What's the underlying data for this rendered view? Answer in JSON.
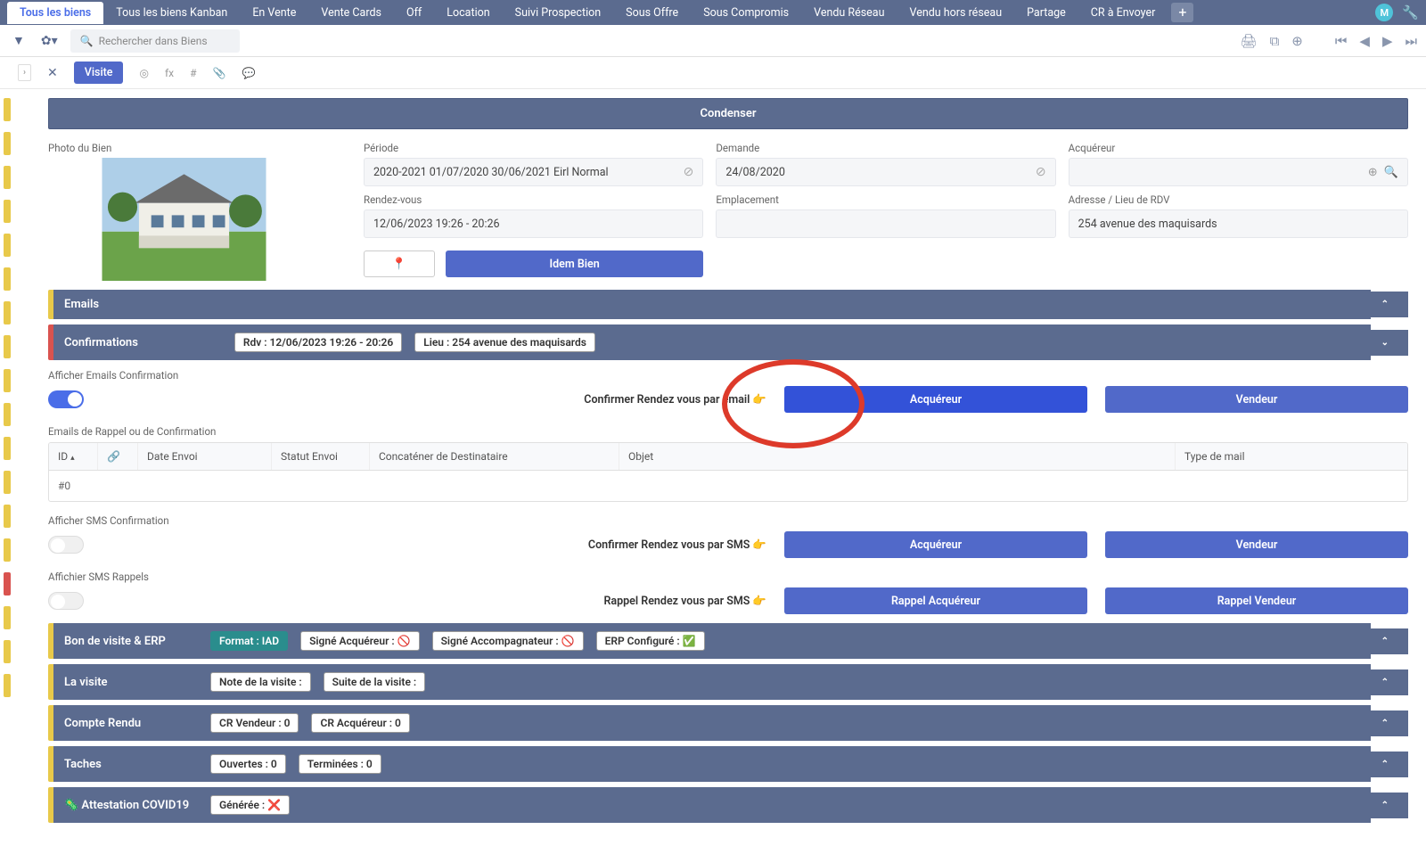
{
  "tabs": [
    "Tous les biens",
    "Tous les biens Kanban",
    "En Vente",
    "Vente Cards",
    "Off",
    "Location",
    "Suivi Prospection",
    "Sous Offre",
    "Sous Compromis",
    "Vendu Réseau",
    "Vendu hors réseau",
    "Partage",
    "CR à Envoyer"
  ],
  "avatar_letter": "M",
  "search_placeholder": "Rechercher dans Biens",
  "record_chip": "Visite",
  "fx_label": "fx",
  "hash_label": "#",
  "condenser": "Condenser",
  "fields": {
    "photo_label": "Photo du Bien",
    "periode_label": "Période",
    "periode_value": "2020-2021 01/07/2020 30/06/2021 Eirl Normal",
    "demande_label": "Demande",
    "demande_value": "24/08/2020",
    "acquereur_label": "Acquéreur",
    "rdv_label": "Rendez-vous",
    "rdv_value": "12/06/2023 19:26 - 20:26",
    "emplacement_label": "Emplacement",
    "adresse_label": "Adresse / Lieu de RDV",
    "adresse_value": "254 avenue des maquisards",
    "idem_bien": "Idem Bien"
  },
  "sections": {
    "emails": "Emails",
    "confirmations": "Confirmations",
    "rdv_chip": "Rdv : 12/06/2023 19:26 - 20:26",
    "lieu_chip": "Lieu : 254 avenue des maquisards",
    "afficher_emails": "Afficher Emails Confirmation",
    "confirmer_email": "Confirmer Rendez vous par email",
    "acquereur_btn": "Acquéreur",
    "vendeur_btn": "Vendeur",
    "emails_rappel": "Emails de Rappel ou de Confirmation",
    "afficher_sms": "Afficher SMS Confirmation",
    "confirmer_sms": "Confirmer Rendez vous par SMS",
    "afficher_sms_rappels": "Affichier SMS Rappels",
    "rappel_sms": "Rappel Rendez vous par SMS",
    "rappel_acq": "Rappel Acquéreur",
    "rappel_vend": "Rappel Vendeur",
    "bon_visite": "Bon de visite & ERP",
    "format_iad": "Format : IAD",
    "signe_acq": "Signé Acquéreur : ",
    "signe_acc": "Signé Accompagnateur : ",
    "erp_conf": "ERP Configuré : ",
    "la_visite": "La visite",
    "note_visite": "Note de la visite :",
    "suite_visite": "Suite de la visite :",
    "compte_rendu": "Compte Rendu",
    "cr_vendeur": "CR Vendeur : 0",
    "cr_acq": "CR Acquéreur : 0",
    "taches": "Taches",
    "ouvertes": "Ouvertes : 0",
    "terminees": "Terminées : 0",
    "covid": "Attestation COVID19",
    "generee": "Générée : "
  },
  "table": {
    "cols": [
      "ID",
      "",
      "Date Envoi",
      "Statut Envoi",
      "Concaténer de Destinataire",
      "Objet",
      "Type de mail"
    ],
    "row0": "#0"
  }
}
